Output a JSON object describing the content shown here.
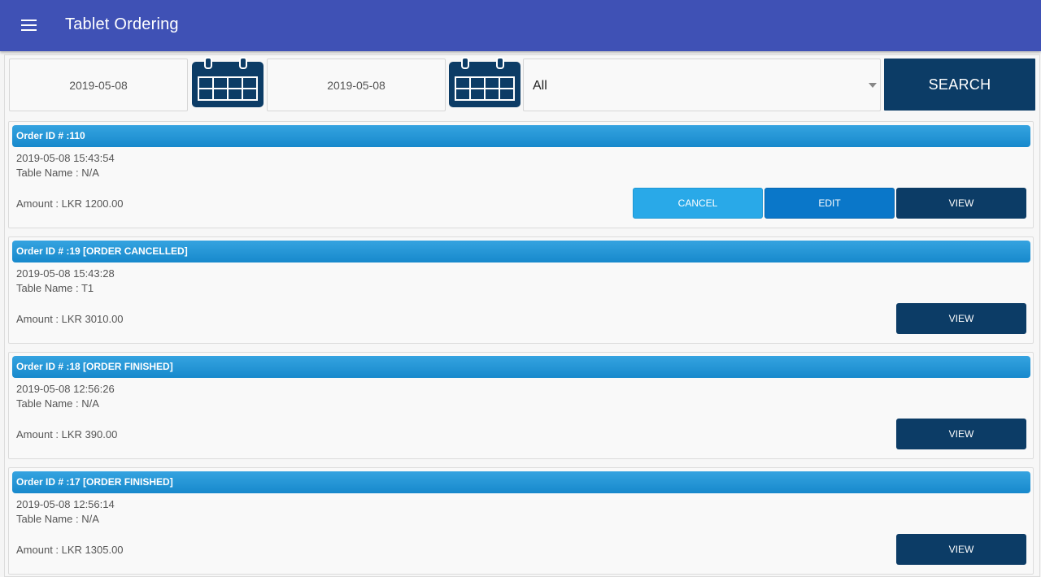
{
  "appbar": {
    "title": "Tablet Ordering",
    "menu_icon": "hamburger-menu-icon"
  },
  "filters": {
    "from_date": "2019-05-08",
    "to_date": "2019-05-08",
    "calendar_icon": "calendar-icon",
    "status_select": {
      "selected": "All"
    },
    "search_label": "SEARCH"
  },
  "orders": [
    {
      "header": "Order ID # :110",
      "datetime": "2019-05-08 15:43:54",
      "table": "Table Name : N/A",
      "amount": "Amount : LKR 1200.00",
      "cancel_label": "CANCEL",
      "edit_label": "EDIT",
      "view_label": "VIEW"
    },
    {
      "header": "Order ID # :19 [ORDER CANCELLED]",
      "datetime": "2019-05-08 15:43:28",
      "table": "Table Name : T1",
      "amount": "Amount : LKR 3010.00",
      "view_label": "VIEW"
    },
    {
      "header": "Order ID # :18 [ORDER FINISHED]",
      "datetime": "2019-05-08 12:56:26",
      "table": "Table Name : N/A",
      "amount": "Amount : LKR 390.00",
      "view_label": "VIEW"
    },
    {
      "header": "Order ID # :17 [ORDER FINISHED]",
      "datetime": "2019-05-08 12:56:14",
      "table": "Table Name : N/A",
      "amount": "Amount : LKR 1305.00",
      "view_label": "VIEW"
    }
  ],
  "colors": {
    "appbar": "#3f51b5",
    "card_header": "#1e95d6",
    "view_button": "#0c3c66",
    "edit_button": "#0a77c9",
    "cancel_button": "#29a9e8"
  }
}
